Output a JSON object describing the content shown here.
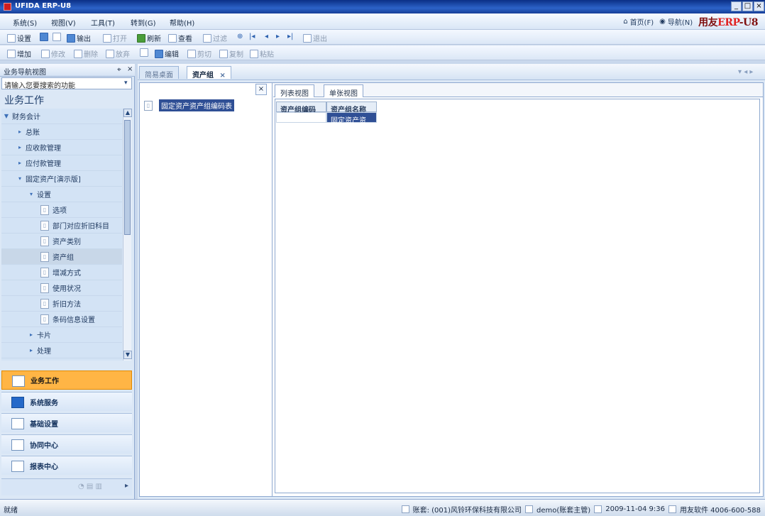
{
  "window": {
    "title": "UFIDA ERP-U8",
    "buttons": [
      "_",
      "□",
      "×"
    ]
  },
  "menu": [
    "系统(S)",
    "视图(V)",
    "工具(T)",
    "转到(G)",
    "帮助(H)"
  ],
  "header_links": [
    {
      "label": "首页(F)",
      "icon": "home-icon"
    },
    {
      "label": "导航(N)",
      "icon": "navigation-icon"
    }
  ],
  "brand": {
    "prefix": "用友",
    "erp": "ERP",
    "suffix": "-U8"
  },
  "toolbar_primary": [
    {
      "label": "设置",
      "icon": "settings-icon",
      "enabled": true
    },
    {
      "label": "",
      "icon": "print-icon",
      "enabled": true
    },
    {
      "label": "",
      "icon": "preview-icon",
      "enabled": true
    },
    {
      "label": "输出",
      "icon": "export-icon",
      "enabled": true
    },
    {
      "label": "打开",
      "icon": "open-icon",
      "enabled": false
    },
    {
      "label": "刷新",
      "icon": "refresh-icon",
      "enabled": true
    },
    {
      "label": "查看",
      "icon": "view-icon",
      "enabled": true
    },
    {
      "label": "过滤",
      "icon": "filter-icon",
      "enabled": false
    },
    {
      "label": "",
      "icon": "search-icon",
      "enabled": true
    },
    {
      "label": "",
      "icon": "first-icon",
      "enabled": true
    },
    {
      "label": "",
      "icon": "previous-icon",
      "enabled": true
    },
    {
      "label": "",
      "icon": "next-icon",
      "enabled": true
    },
    {
      "label": "",
      "icon": "last-icon",
      "enabled": true
    },
    {
      "label": "退出",
      "icon": "exit-icon",
      "enabled": false
    }
  ],
  "toolbar_secondary": [
    {
      "label": "增加",
      "icon": "add-icon",
      "enabled": true
    },
    {
      "label": "修改",
      "icon": "edit-icon",
      "enabled": false
    },
    {
      "label": "删除",
      "icon": "delete-icon",
      "enabled": false
    },
    {
      "label": "放弃",
      "icon": "cancel-icon",
      "enabled": false
    },
    {
      "label": "",
      "icon": "save-icon",
      "enabled": false
    },
    {
      "label": "编辑",
      "icon": "compile-icon",
      "enabled": true
    },
    {
      "label": "剪切",
      "icon": "cut-icon",
      "enabled": false
    },
    {
      "label": "复制",
      "icon": "copy-icon",
      "enabled": false
    },
    {
      "label": "粘贴",
      "icon": "paste-icon",
      "enabled": false
    }
  ],
  "left_panel": {
    "title": "业务导航视图",
    "search_placeholder": "请输入您要搜索的功能",
    "section_title": "业务工作",
    "tree": [
      {
        "label": "财务会计",
        "type": "group",
        "level": 0,
        "expanded": true
      },
      {
        "label": "总账",
        "type": "group",
        "level": 1,
        "expanded": false
      },
      {
        "label": "应收款管理",
        "type": "group",
        "level": 1,
        "expanded": false
      },
      {
        "label": "应付款管理",
        "type": "group",
        "level": 1,
        "expanded": false
      },
      {
        "label": "固定资产[演示版]",
        "type": "group",
        "level": 1,
        "expanded": true
      },
      {
        "label": "设置",
        "type": "group",
        "level": 2,
        "expanded": true
      },
      {
        "label": "选项",
        "type": "item",
        "level": 3
      },
      {
        "label": "部门对应折旧科目",
        "type": "item",
        "level": 3
      },
      {
        "label": "资产类别",
        "type": "item",
        "level": 3
      },
      {
        "label": "资产组",
        "type": "item",
        "level": 3,
        "selected": true
      },
      {
        "label": "增减方式",
        "type": "item",
        "level": 3
      },
      {
        "label": "使用状况",
        "type": "item",
        "level": 3
      },
      {
        "label": "折旧方法",
        "type": "item",
        "level": 3
      },
      {
        "label": "条码信息设置",
        "type": "item",
        "level": 3
      },
      {
        "label": "卡片",
        "type": "group",
        "level": 2,
        "expanded": false
      },
      {
        "label": "处理",
        "type": "group",
        "level": 2,
        "expanded": false
      }
    ],
    "modules": [
      {
        "label": "业务工作",
        "icon": "business-icon",
        "active": true
      },
      {
        "label": "系统服务",
        "icon": "system-service-icon",
        "active": false
      },
      {
        "label": "基础设置",
        "icon": "basic-settings-icon",
        "active": false
      },
      {
        "label": "协同中心",
        "icon": "collaboration-icon",
        "active": false
      },
      {
        "label": "报表中心",
        "icon": "report-icon",
        "active": false
      }
    ]
  },
  "tabs": [
    {
      "label": "简易桌面",
      "active": false
    },
    {
      "label": "资产组",
      "active": true
    }
  ],
  "content": {
    "tree_root": "固定资产资产组编码表",
    "view_tabs": [
      "列表视图",
      "单张视图"
    ],
    "columns": [
      "资产组编码",
      "资产组名称"
    ],
    "rows": [
      [
        "",
        "固定资产资产"
      ]
    ]
  },
  "status": {
    "left": "就绪",
    "account": "账套: (001)风铃环保科技有限公司",
    "user": "demo(账套主管)",
    "datetime": "2009-11-04 9:36",
    "support": "用友软件 4006-600-588"
  }
}
